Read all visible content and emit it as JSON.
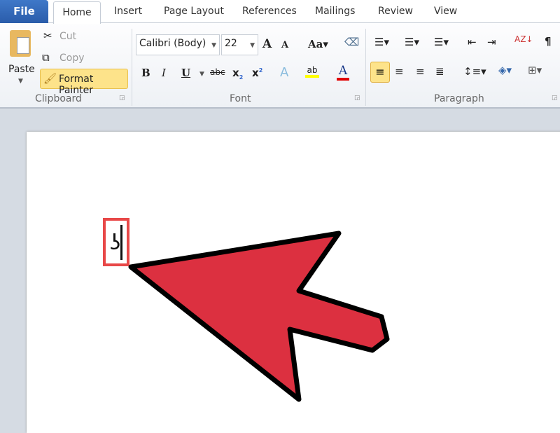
{
  "tabs": {
    "file": "File",
    "home": "Home",
    "insert": "Insert",
    "page_layout": "Page Layout",
    "references": "References",
    "mailings": "Mailings",
    "review": "Review",
    "view": "View"
  },
  "clipboard": {
    "label": "Clipboard",
    "paste": "Paste",
    "cut": "Cut",
    "copy": "Copy",
    "format_painter": "Format Painter"
  },
  "font": {
    "label": "Font",
    "font_name": "Calibri (Body)",
    "font_size": "22"
  },
  "paragraph": {
    "label": "Paragraph"
  },
  "document": {
    "text": "ʖ"
  },
  "colors": {
    "highlight": "#ffff00",
    "font_color": "#e00000",
    "arrow": "#dc3040",
    "box": "#e84848",
    "active": "#fde38a"
  }
}
